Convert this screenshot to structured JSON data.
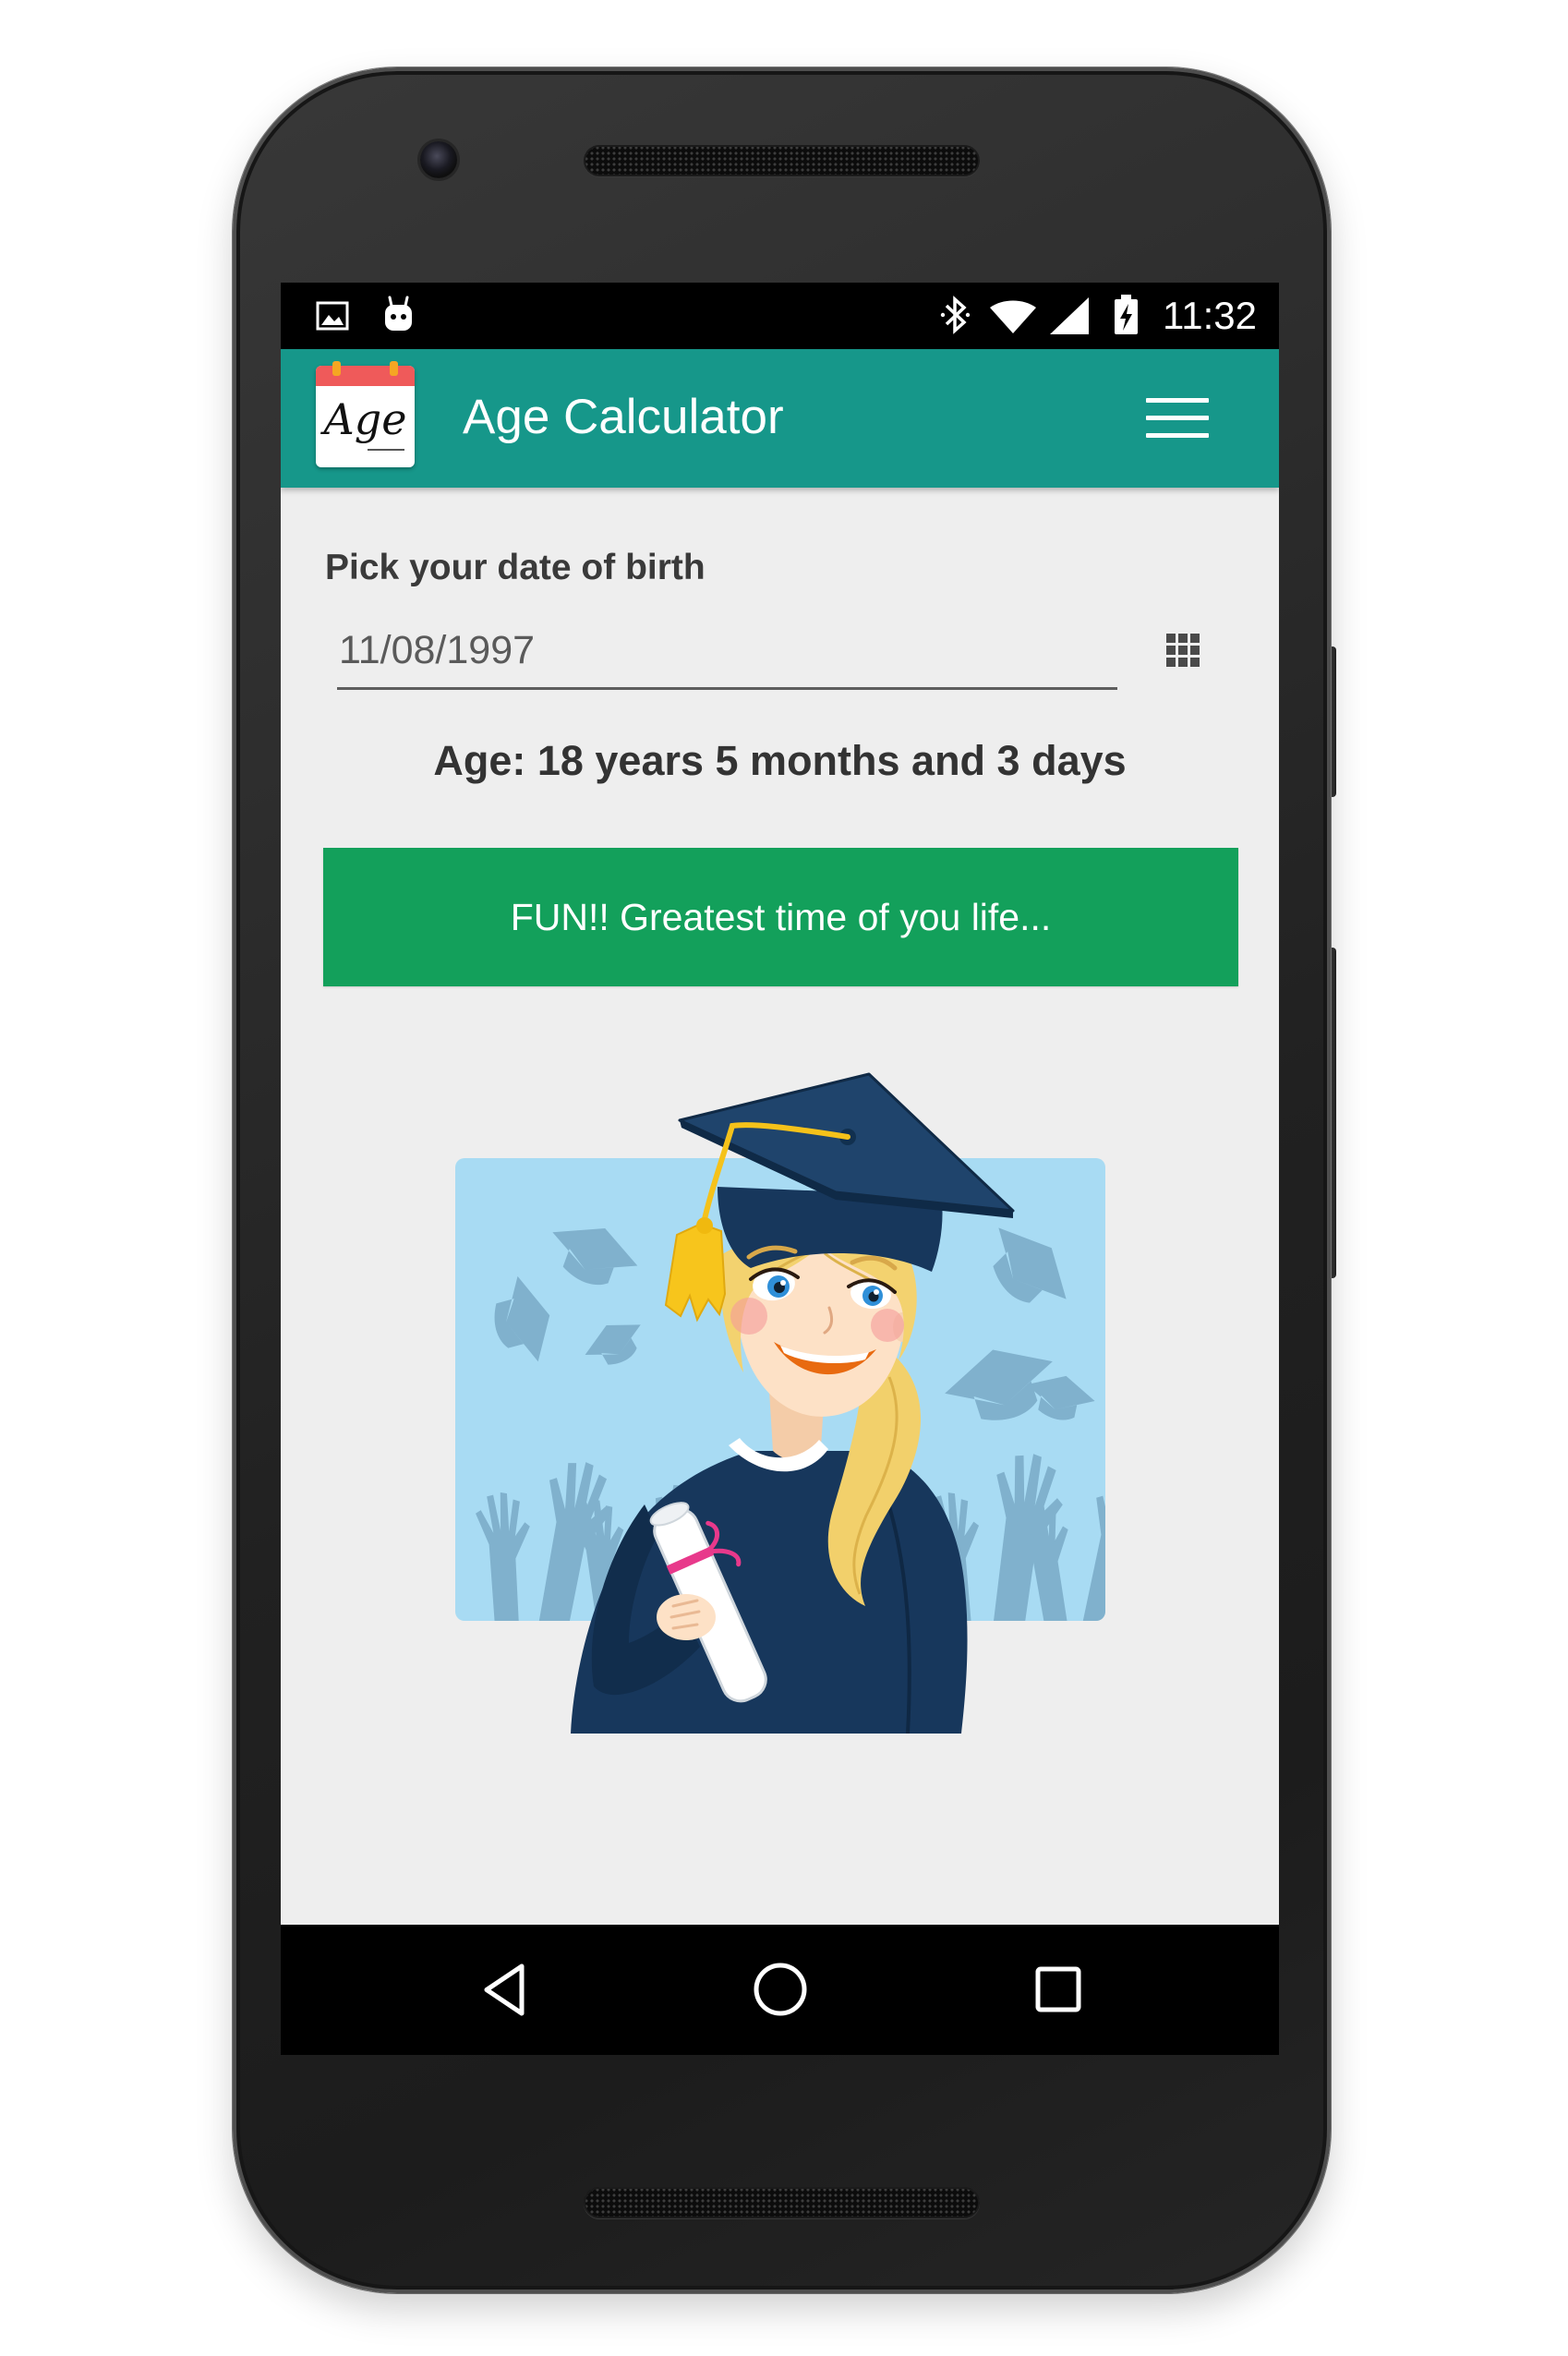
{
  "status_bar": {
    "time": "11:32",
    "left_icons": [
      "image-notification-icon",
      "android-notification-icon"
    ],
    "right_icons": [
      "bluetooth-icon",
      "wifi-icon",
      "cellular-signal-icon",
      "battery-charging-icon"
    ]
  },
  "app_bar": {
    "title": "Age Calculator",
    "logo": {
      "icon": "age-calendar-logo",
      "text": "Age"
    },
    "menu_icon": "hamburger-menu-icon"
  },
  "form": {
    "label": "Pick your date of birth",
    "date_value": "11/08/1997",
    "picker_icon": "grid-icon"
  },
  "result": {
    "age_text": "Age: 18 years 5 months and 3 days",
    "message_button": "FUN!! Greatest time of you life..."
  },
  "nav_bar": {
    "icons": [
      "back-icon",
      "home-icon",
      "recent-apps-icon"
    ]
  },
  "colors": {
    "status_bar": "#000000",
    "app_bar": "#16978a",
    "content_background": "#eeeeee",
    "message_button": "#13a05b",
    "nav_bar": "#000000"
  }
}
